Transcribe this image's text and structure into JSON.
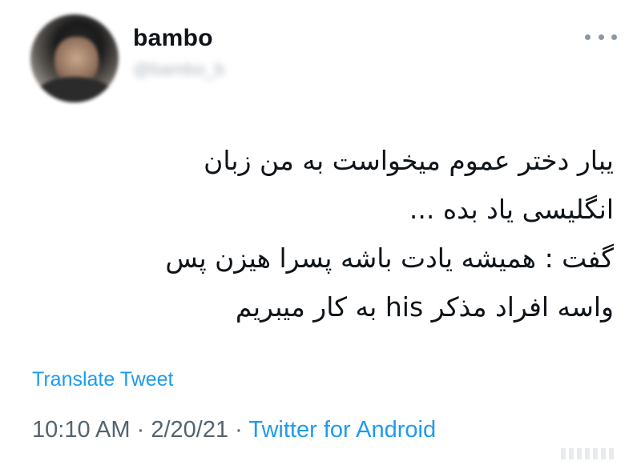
{
  "tweet": {
    "author": {
      "display_name": "bambo",
      "handle": "@bambo_b"
    },
    "text_lines": [
      "یبار دختر عموم میخواست به من زبان",
      "انگلیسی یاد بده ...",
      "گفت : همیشه یادت باشه پسرا هیزن پس",
      "واسه افراد مذکر his به کار میبریم"
    ],
    "translate_label": "Translate Tweet",
    "time": "10:10 AM",
    "separator": "·",
    "date": "2/20/21",
    "source": "Twitter for Android"
  },
  "colors": {
    "link": "#1d9bf0",
    "meta": "#536471",
    "text": "#0f1419"
  },
  "icons": {
    "more": "more-horizontal-icon",
    "avatar": "profile-avatar"
  }
}
